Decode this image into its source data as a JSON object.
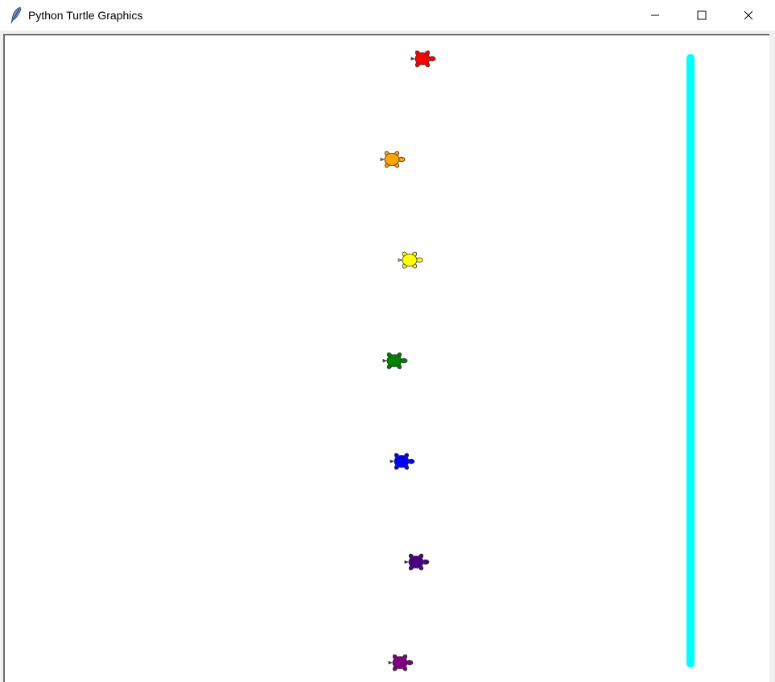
{
  "window": {
    "title": "Python Turtle Graphics",
    "controls": {
      "minimize_icon": "minimize-icon",
      "maximize_icon": "maximize-icon",
      "close_icon": "close-icon"
    },
    "app_icon": "feather-icon"
  },
  "canvas": {
    "background": "#ffffff",
    "finish_line_color": "#00ffff",
    "turtles": [
      {
        "color": "#ff0000"
      },
      {
        "color": "#ffa500"
      },
      {
        "color": "#ffff00"
      },
      {
        "color": "#008000"
      },
      {
        "color": "#0000ff"
      },
      {
        "color": "#4b0082"
      },
      {
        "color": "#800080"
      }
    ]
  }
}
